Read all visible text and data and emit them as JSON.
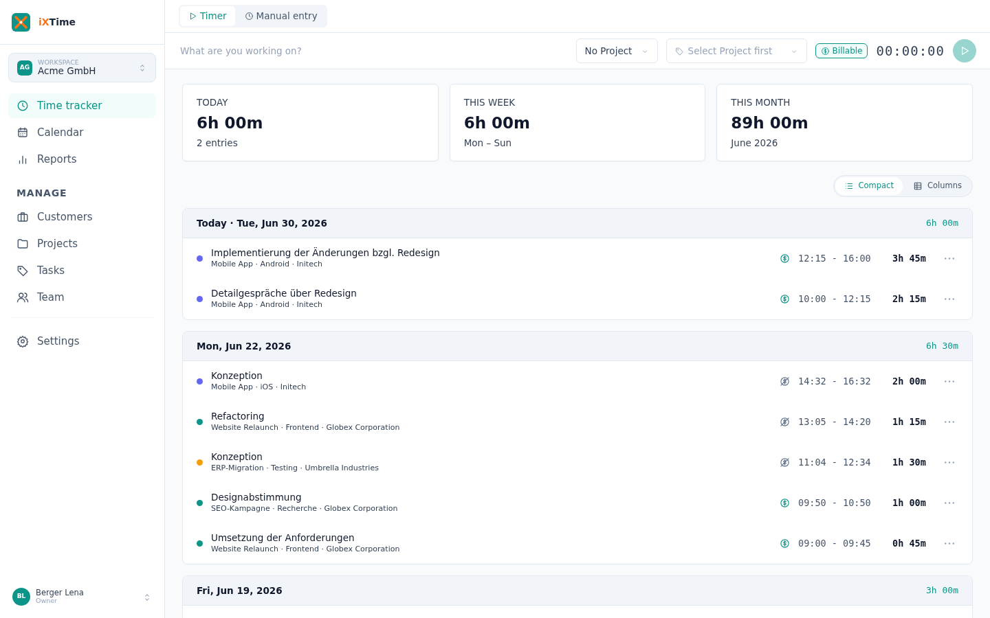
{
  "app": {
    "name_prefix": "iX",
    "name_suffix": "Time"
  },
  "workspace": {
    "label": "WORKSPACE",
    "initials": "AG",
    "name": "Acme GmbH"
  },
  "nav": [
    {
      "label": "Time tracker",
      "selected": true
    },
    {
      "label": "Calendar",
      "selected": false
    },
    {
      "label": "Reports",
      "selected": false
    }
  ],
  "manage": {
    "heading": "MANAGE",
    "items": [
      {
        "label": "Customers",
        "selected": false
      },
      {
        "label": "Projects",
        "selected": false
      },
      {
        "label": "Tasks",
        "selected": false
      },
      {
        "label": "Team",
        "selected": false
      }
    ]
  },
  "settings": {
    "label": "Settings",
    "selected": false
  },
  "user": {
    "initials": "BL",
    "name": "Berger Lena",
    "role": "Owner"
  },
  "mode_tabs": [
    {
      "label": "Timer",
      "selected": true
    },
    {
      "label": "Manual entry",
      "selected": false
    }
  ],
  "timer": {
    "placeholder": "What are you working on?",
    "project": "No Project",
    "task_placeholder": "Select Project first",
    "billable": {
      "label": "Billable",
      "on": true
    },
    "clock": "00:00:00"
  },
  "stats": [
    {
      "label": "TODAY",
      "value": "6h 00m",
      "sub": "2 entries"
    },
    {
      "label": "THIS WEEK",
      "value": "6h 00m",
      "sub": "Mon – Sun"
    },
    {
      "label": "THIS MONTH",
      "value": "89h 00m",
      "sub": "June 2026"
    }
  ],
  "view_toggle": [
    {
      "label": "Compact",
      "selected": true
    },
    {
      "label": "Columns",
      "selected": false
    }
  ],
  "days": [
    {
      "title": "Today · Tue, Jun 30, 2026",
      "total": "6h 00m",
      "entries": [
        {
          "title": "Implementierung der Änderungen bzgl. Redesign",
          "meta": "Mobile App · Android · Initech",
          "color": "#6366f1",
          "billable": true,
          "time": "12:15 - 16:00",
          "duration": "3h 45m"
        },
        {
          "title": "Detailgespräche über Redesign",
          "meta": "Mobile App · Android · Initech",
          "color": "#6366f1",
          "billable": true,
          "time": "10:00 - 12:15",
          "duration": "2h 15m"
        }
      ]
    },
    {
      "title": "Mon, Jun 22, 2026",
      "total": "6h 30m",
      "entries": [
        {
          "title": "Konzeption",
          "meta": "Mobile App · iOS · Initech",
          "color": "#6366f1",
          "billable": false,
          "time": "14:32 - 16:32",
          "duration": "2h 00m"
        },
        {
          "title": "Refactoring",
          "meta": "Website Relaunch · Frontend · Globex Corporation",
          "color": "#0d9488",
          "billable": false,
          "time": "13:05 - 14:20",
          "duration": "1h 15m"
        },
        {
          "title": "Konzeption",
          "meta": "ERP-Migration · Testing · Umbrella Industries",
          "color": "#f59e0b",
          "billable": false,
          "time": "11:04 - 12:34",
          "duration": "1h 30m"
        },
        {
          "title": "Designabstimmung",
          "meta": "SEO-Kampagne · Recherche · Globex Corporation",
          "color": "#0d9488",
          "billable": true,
          "time": "09:50 - 10:50",
          "duration": "1h 00m"
        },
        {
          "title": "Umsetzung der Anforderungen",
          "meta": "Website Relaunch · Frontend · Globex Corporation",
          "color": "#0d9488",
          "billable": true,
          "time": "09:00 - 09:45",
          "duration": "0h 45m"
        }
      ]
    },
    {
      "title": "Fri, Jun 19, 2026",
      "total": "3h 00m"
    }
  ]
}
